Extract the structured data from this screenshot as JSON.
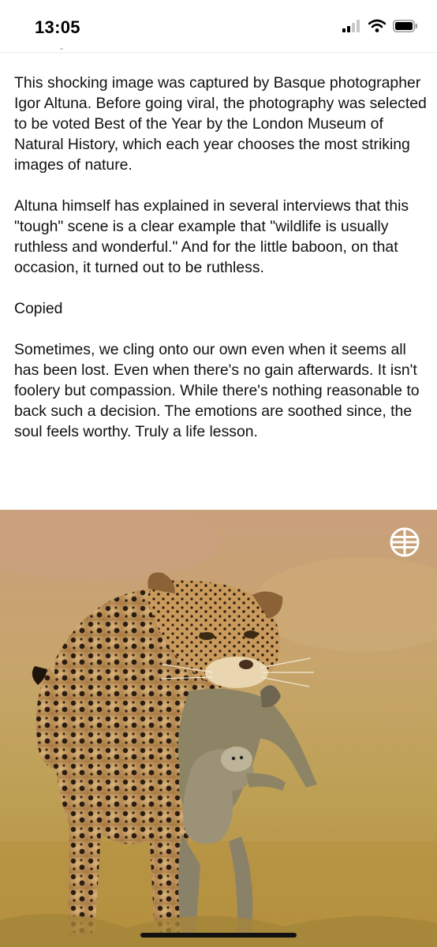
{
  "status_bar": {
    "time": "13:05",
    "signal_icon": "cellular-signal-icon",
    "wifi_icon": "wifi-icon",
    "battery_icon": "battery-icon"
  },
  "post": {
    "paragraphs": [
      "This shocking image was captured by Basque photographer Igor Altuna. Before going viral, the photography was selected to be voted Best of the Year by the London Museum of Natural History, which each year chooses the most striking images of nature.",
      "Altuna himself has explained in several interviews that this \"tough\" scene is a clear example that \"wildlife is usually ruthless and wonderful.\" And for the little baboon, on that occasion, it turned out to be ruthless.",
      "Copied",
      "Sometimes, we cling onto our own even when it seems all has been lost. Even when there's no gain afterwards. It isn't foolery but compassion. While there's nothing reasonable to back such a decision. The emotions are soothed since, the soul feels worthy. Truly a life lesson."
    ]
  },
  "photo": {
    "subject": "leopard carrying a baboon with a baby baboon clinging to it",
    "watermark_icon": "globe-watermark-icon"
  },
  "colors": {
    "background": "#ffffff",
    "text": "#111111",
    "photo_ground": "#b89a4a",
    "photo_sky": "#caa37a",
    "leopard_coat": "#c79a5a"
  }
}
